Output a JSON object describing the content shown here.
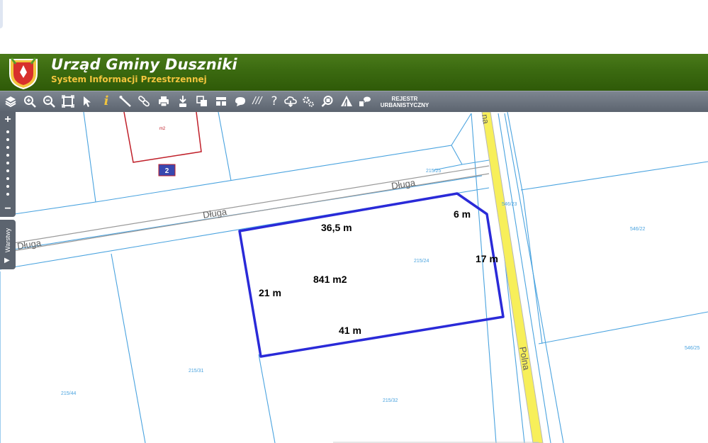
{
  "header": {
    "title": "Urząd Gminy Duszniki",
    "subtitle": "System Informacji Przestrzennej"
  },
  "toolbar": {
    "tools": [
      "layers-icon",
      "zoom-in-icon",
      "zoom-out-icon",
      "zoom-extent-icon",
      "select-arrow-icon",
      "info-icon",
      "measure-distance-icon",
      "link-icon",
      "print-icon",
      "download-icon",
      "copy-icon",
      "layout-icon",
      "area-icon",
      "hatch-icon",
      "help-icon",
      "cloud-icon",
      "settings-icon",
      "search-parcel-icon",
      "warning-icon",
      "comment-icon"
    ],
    "info_glyph": "i",
    "hatch_glyph": "///",
    "help_glyph": "?",
    "rejestr_line1": "REJESTR",
    "rejestr_line2": "URBANISTYCZNY"
  },
  "map_controls": {
    "zoom_in": "+",
    "zoom_out": "−",
    "layers_tab": "Warstwy",
    "layers_arrow": "▶"
  },
  "map": {
    "streets": {
      "dluga_1": "Długa",
      "dluga_2": "Długa",
      "dluga_3": "Długa",
      "polna_top": "na",
      "polna_bottom": "Polna"
    },
    "building": {
      "label": "m2",
      "number": "2"
    },
    "parcels": {
      "p1": "215/25",
      "p2": "546/23",
      "p3": "546/22",
      "p4": "215/24",
      "p5": "546/25",
      "p6": "215/31",
      "p7": "215/44",
      "p8": "215/32"
    },
    "measurements": {
      "top_edge": "36,5 m",
      "corner_edge": "6 m",
      "right_edge": "17 m",
      "area": "841 m2",
      "left_edge": "21 m",
      "bottom_edge": "41 m"
    },
    "colors": {
      "parcel_line": "#4aa3df",
      "selection": "#2a2ad8",
      "road_fill": "#f7ef5a",
      "building_outline": "#c0202a",
      "banner_green": "#3b6a10",
      "toolbar_grey": "#5c646f"
    }
  }
}
